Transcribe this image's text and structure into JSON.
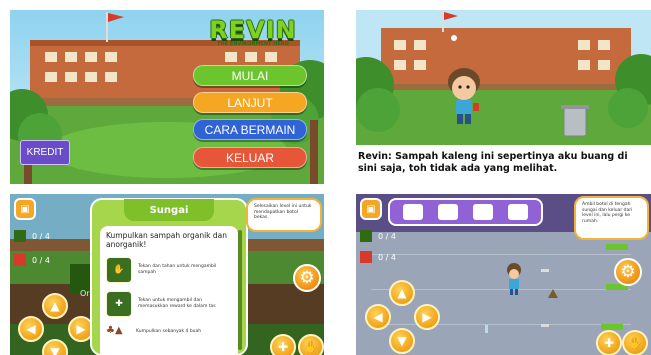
{
  "colors": {
    "sky": "#7ec8e8",
    "grass": "#5fa83b",
    "mulai": "#6cc52d",
    "lanjut": "#f5a623",
    "cara_bermain": "#2f63d6",
    "keluar": "#e8563a",
    "kredit": "#6a4cc8",
    "dialog_green": "#a5d64b",
    "game_floor": "#9aa6b8"
  },
  "title_screen": {
    "logo_title": "REVIN",
    "logo_subtitle": "THE ENVIRONMENT HERO",
    "buttons": {
      "mulai": "MULAI",
      "lanjut": "LANJUT",
      "cara_bermain": "CARA BERMAIN",
      "keluar": "KELUAR"
    },
    "kredit_label": "KREDIT"
  },
  "cutscene": {
    "dialog": "Revin: Sampah kaleng ini sepertinya aku buang di sini saja, toh tidak ada yang melihat."
  },
  "tutorial": {
    "counters": [
      "0 / 4",
      "0 / 4"
    ],
    "side_label": "Organ",
    "dialog_title": "Sungai",
    "dialog_heading": "Kumpulkan sampah organik dan anorganik!",
    "steps": [
      {
        "icon": "hand-icon",
        "text": "Tekan dan tahan untuk mengambil sampah"
      },
      {
        "icon": "plus-icon",
        "text": "Tekan untuk mengambil dan memasukkan reward ke dalam tas"
      },
      {
        "icon": "trash-items-icon",
        "text": "Kumpulkan sebanyak 4 buah"
      }
    ],
    "bubble_text": "Selesaikan level ini untuk mendapatkan botol bekas."
  },
  "level": {
    "counters": [
      "0 / 4",
      "0 / 4"
    ],
    "bubble_text": "Ambil botol di tengah sungai dan keluar dari level ini, lalu pergi ke rumah."
  }
}
